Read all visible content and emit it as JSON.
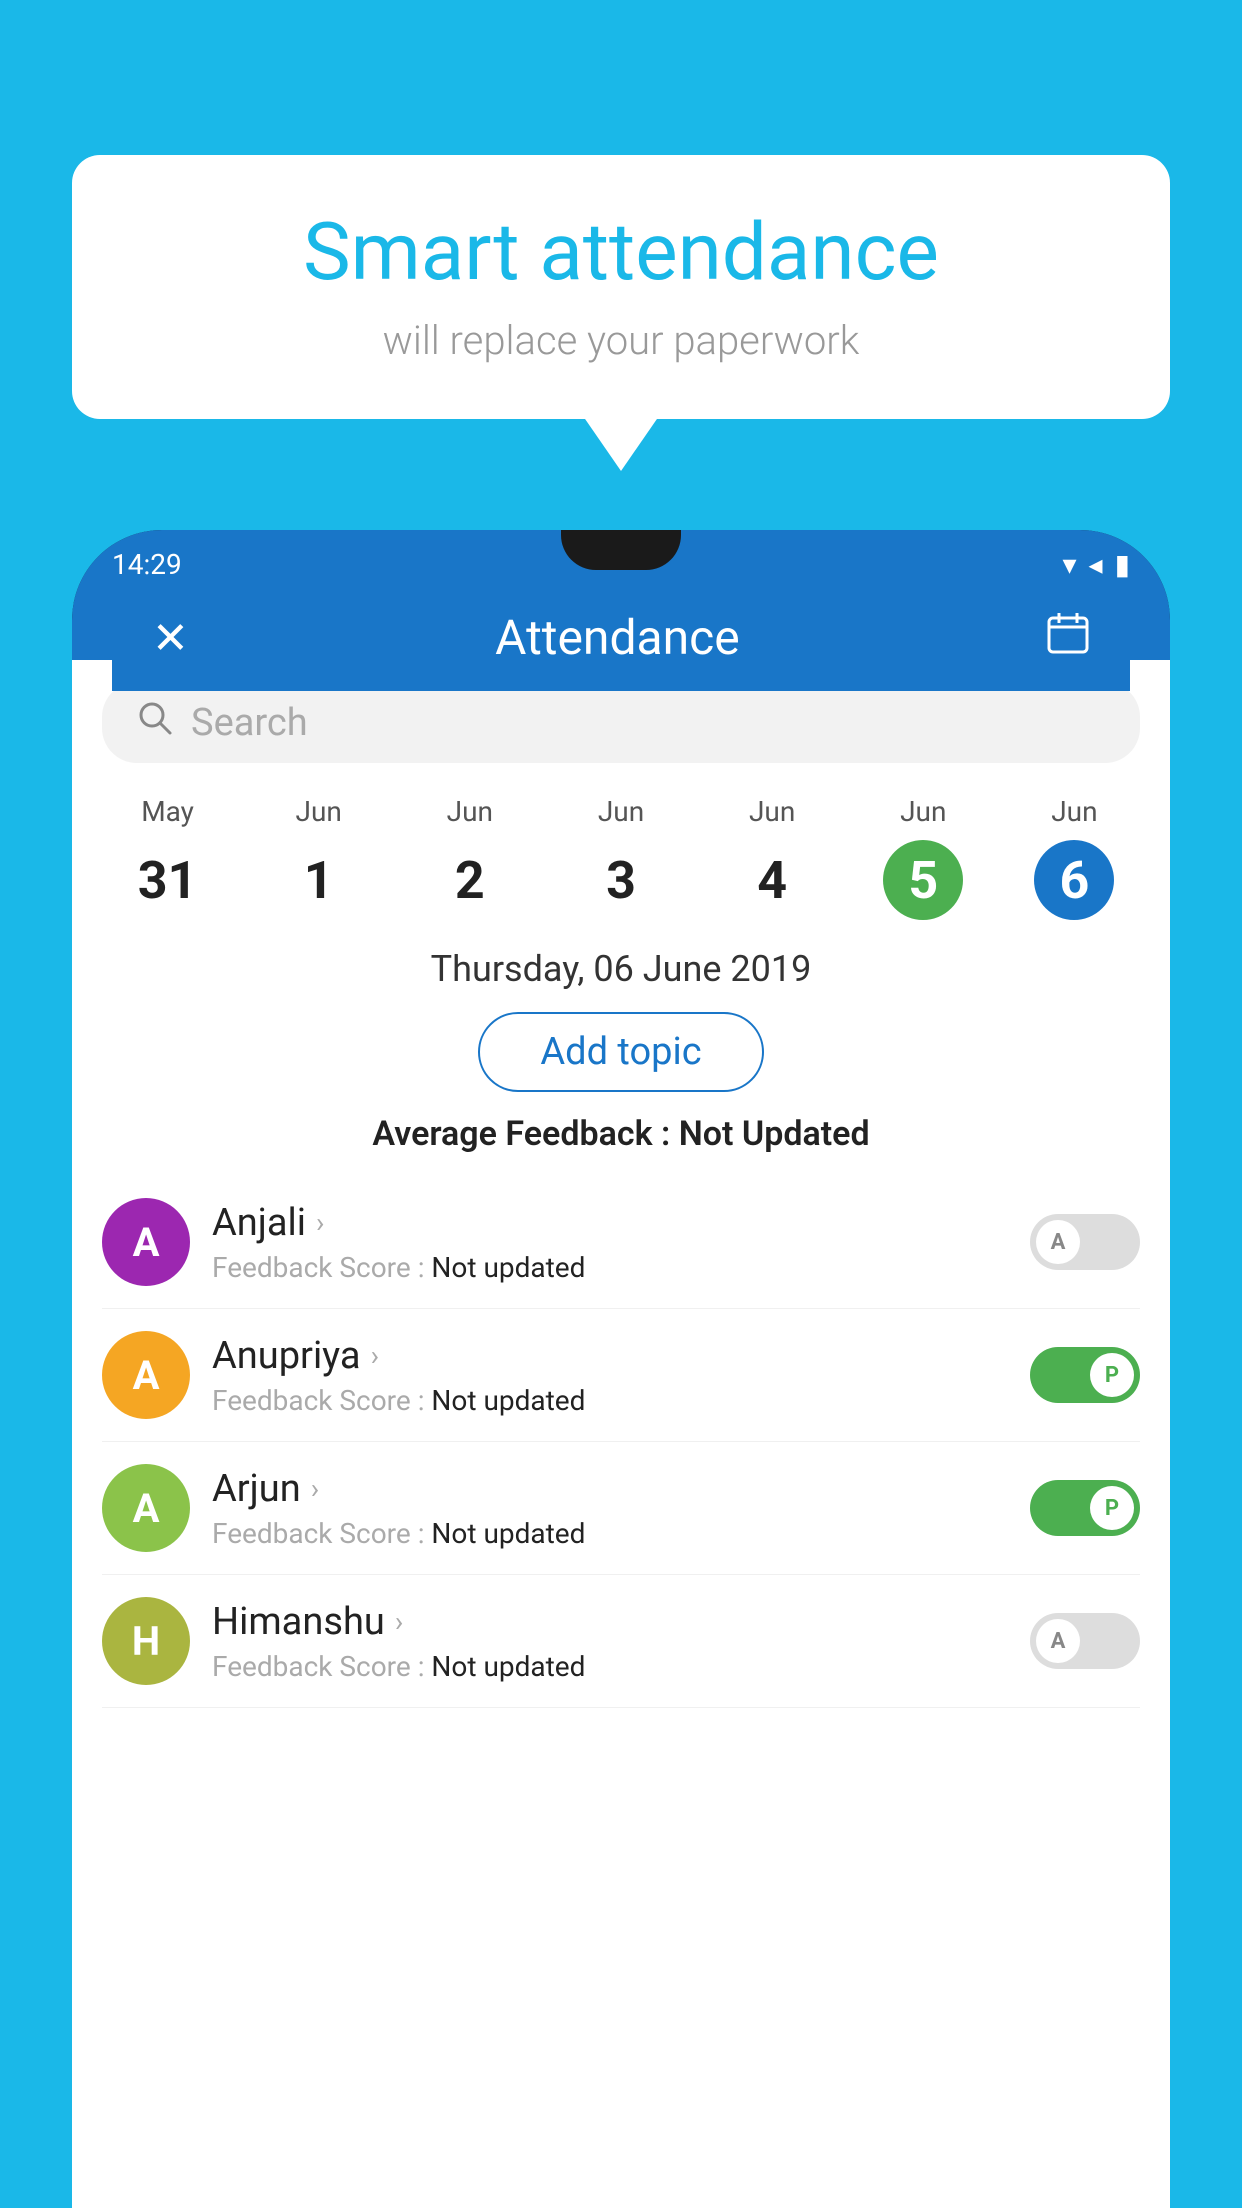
{
  "background_color": "#1ab8e8",
  "speech_bubble": {
    "title": "Smart attendance",
    "subtitle": "will replace your paperwork"
  },
  "status_bar": {
    "time": "14:29",
    "wifi_icon": "▼",
    "signal_icon": "▲",
    "battery_icon": "▮"
  },
  "app_bar": {
    "title": "Attendance",
    "close_icon": "✕",
    "calendar_icon": "📅"
  },
  "search": {
    "placeholder": "Search"
  },
  "calendar": {
    "days": [
      {
        "month": "May",
        "date": "31",
        "state": "normal"
      },
      {
        "month": "Jun",
        "date": "1",
        "state": "normal"
      },
      {
        "month": "Jun",
        "date": "2",
        "state": "normal"
      },
      {
        "month": "Jun",
        "date": "3",
        "state": "normal"
      },
      {
        "month": "Jun",
        "date": "4",
        "state": "normal"
      },
      {
        "month": "Jun",
        "date": "5",
        "state": "today"
      },
      {
        "month": "Jun",
        "date": "6",
        "state": "selected"
      }
    ]
  },
  "selected_date_label": "Thursday, 06 June 2019",
  "add_topic_label": "Add topic",
  "average_feedback": {
    "label": "Average Feedback : ",
    "value": "Not Updated"
  },
  "students": [
    {
      "name": "Anjali",
      "avatar_letter": "A",
      "avatar_color": "#9c27b0",
      "feedback_label": "Feedback Score : ",
      "feedback_value": "Not updated",
      "toggle_state": "off",
      "toggle_label": "A"
    },
    {
      "name": "Anupriya",
      "avatar_letter": "A",
      "avatar_color": "#f5a623",
      "feedback_label": "Feedback Score : ",
      "feedback_value": "Not updated",
      "toggle_state": "on",
      "toggle_label": "P"
    },
    {
      "name": "Arjun",
      "avatar_letter": "A",
      "avatar_color": "#8bc34a",
      "feedback_label": "Feedback Score : ",
      "feedback_value": "Not updated",
      "toggle_state": "on",
      "toggle_label": "P"
    },
    {
      "name": "Himanshu",
      "avatar_letter": "H",
      "avatar_color": "#aab540",
      "feedback_label": "Feedback Score : ",
      "feedback_value": "Not updated",
      "toggle_state": "off",
      "toggle_label": "A"
    }
  ]
}
